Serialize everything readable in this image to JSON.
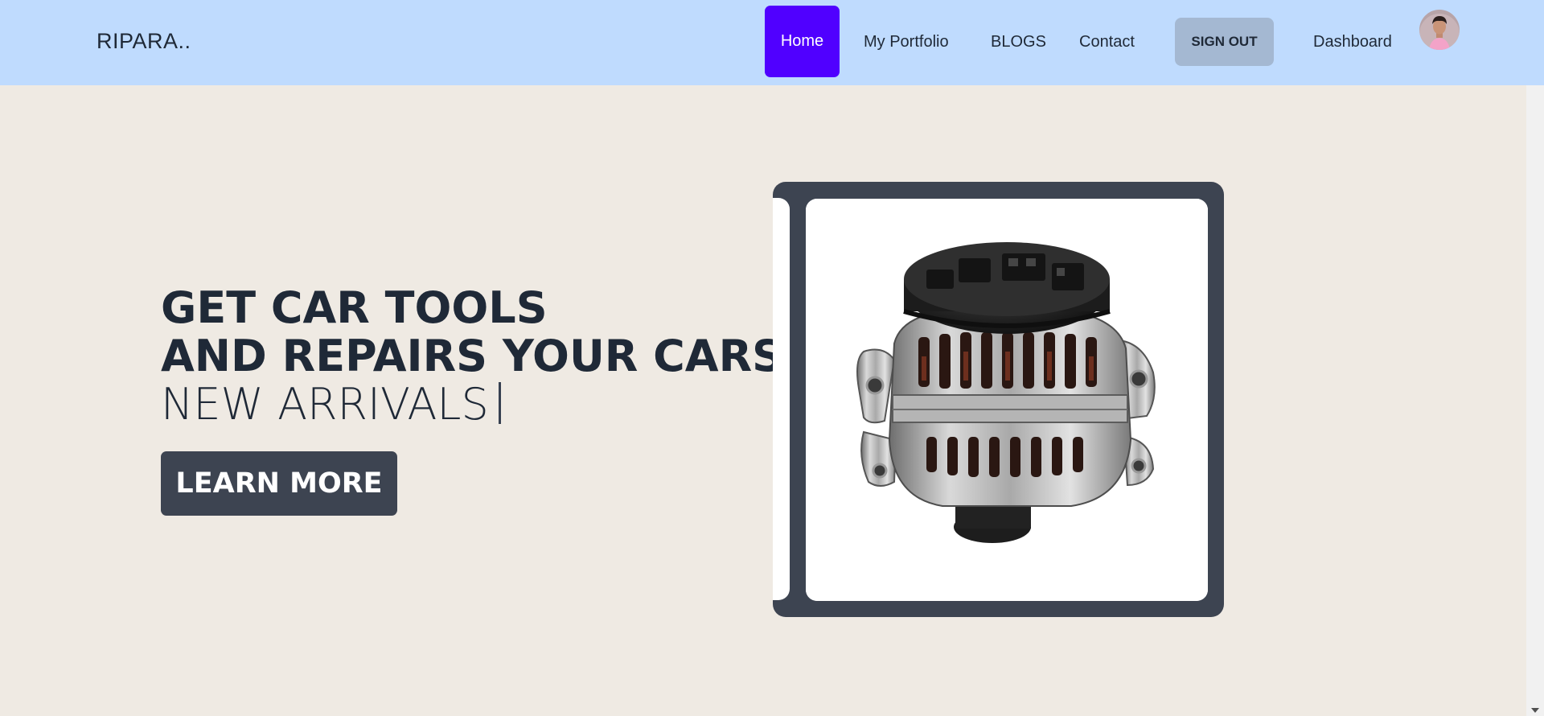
{
  "navbar": {
    "brand": "RIPARA..",
    "items": [
      {
        "label": "Home",
        "active": true
      },
      {
        "label": "My Portfolio"
      },
      {
        "label": "BLOGS"
      },
      {
        "label": "Contact"
      },
      {
        "label": "SIGN OUT"
      },
      {
        "label": "Dashboard"
      }
    ],
    "avatar_icon": "user-avatar"
  },
  "hero": {
    "headline_line1": "GET CAR TOOLS",
    "headline_line2": "AND REPAIRS YOUR CARS",
    "typed_text": "NEW ARRIVALS",
    "cta_label": "LEARN MORE",
    "image_icon": "car-alternator-image"
  },
  "colors": {
    "navbar_bg": "#bfdbfe",
    "page_bg": "#efeae3",
    "active_nav": "#5000ff",
    "signout_bg": "#a4b8d2",
    "dark": "#3d4451",
    "text": "#1f2937"
  }
}
